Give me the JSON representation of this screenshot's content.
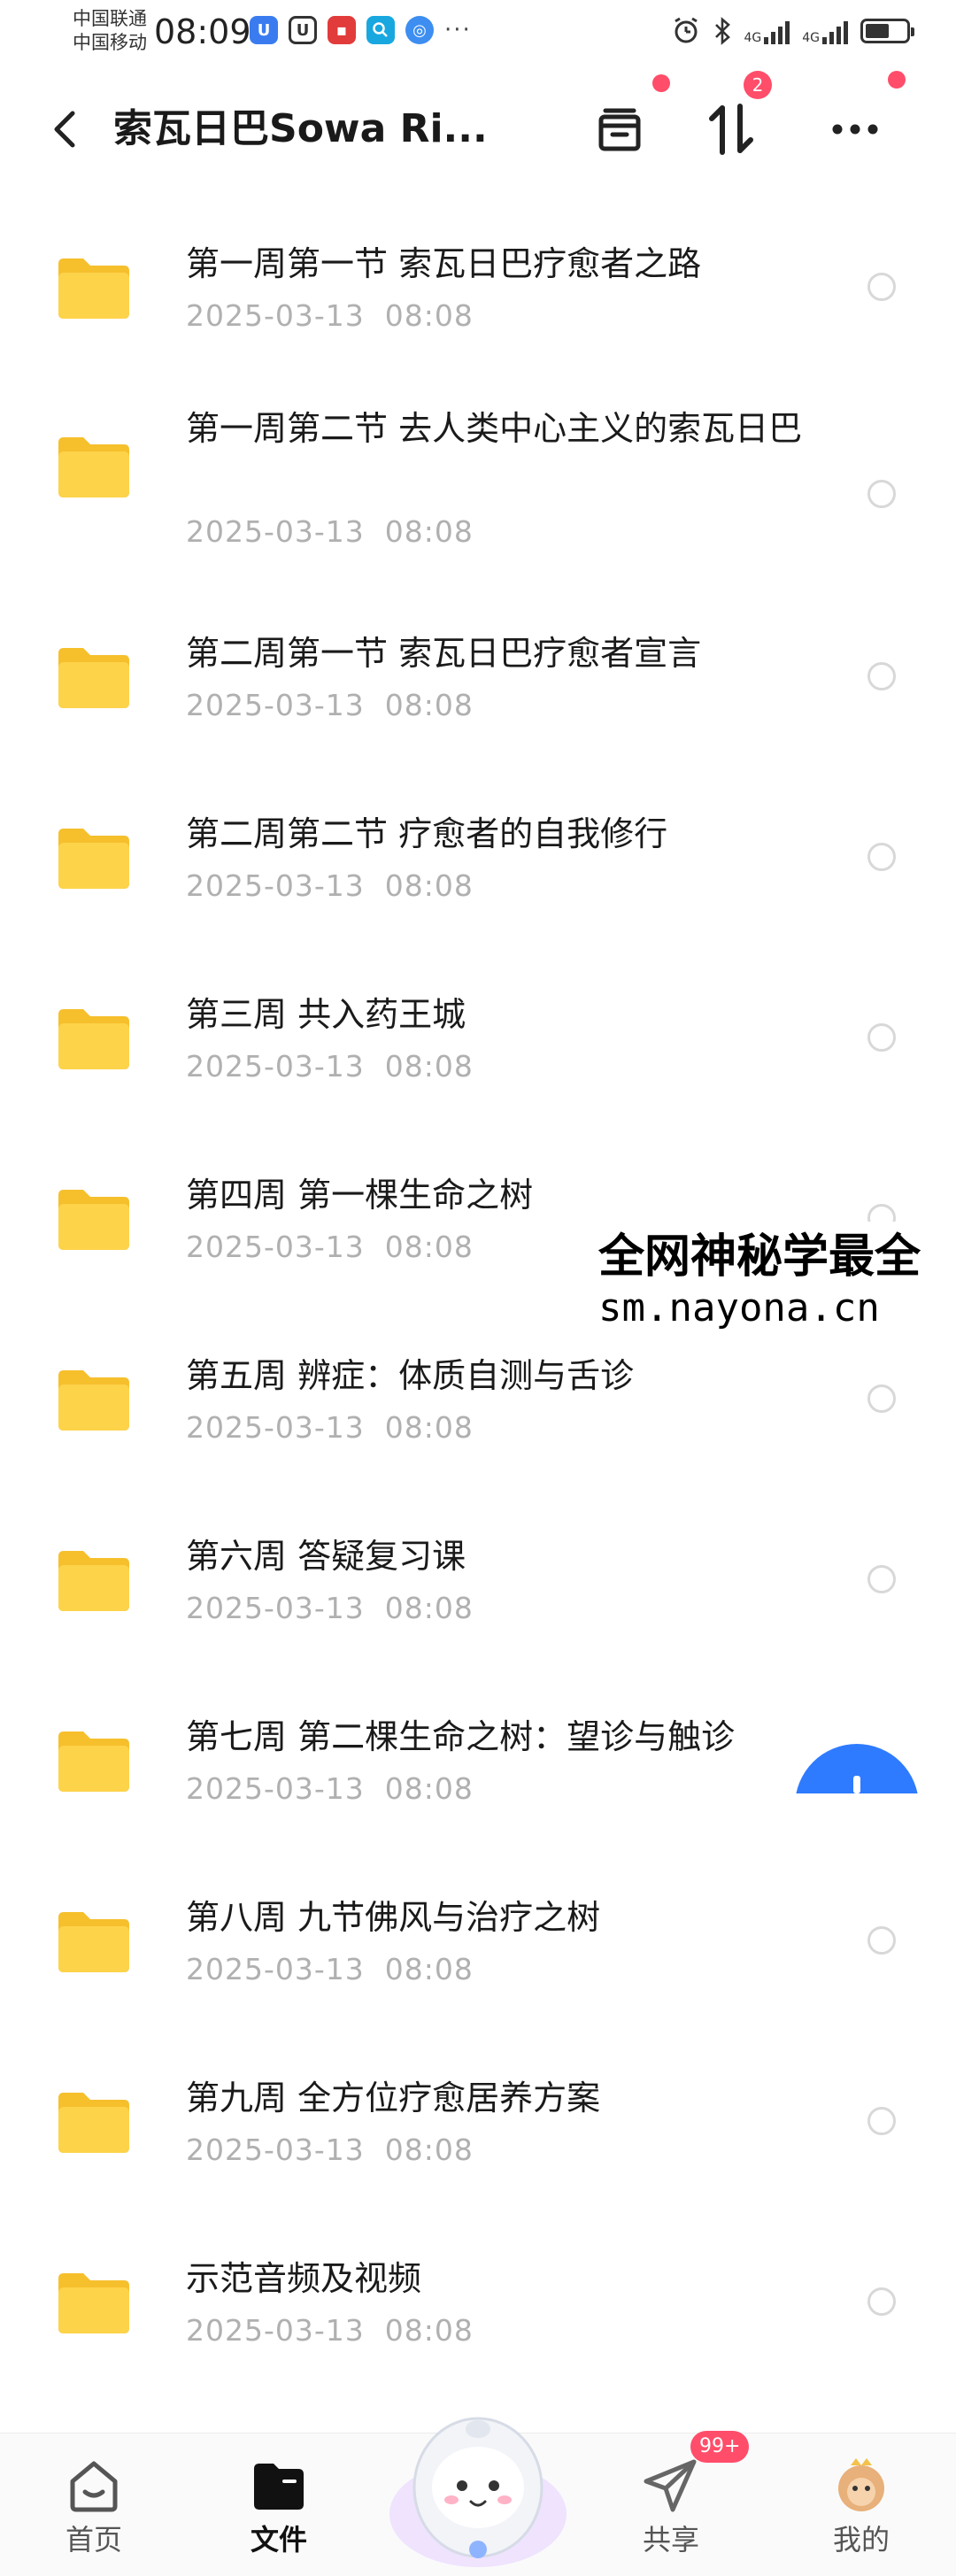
{
  "status_bar": {
    "carrier_1": "中国联通",
    "carrier_2": "中国移动",
    "time": "08:09",
    "more_indicator": "···",
    "network_1": "4G",
    "network_2": "4G"
  },
  "header": {
    "title": "索瓦日巴Sowa Ri...",
    "sort_badge_count": "2",
    "icons": {
      "back": "chevron-left-icon",
      "archive": "archive-box-icon",
      "sort": "sort-arrows-icon",
      "more": "more-dots-icon"
    }
  },
  "files": [
    {
      "name": "第一周第一节 索瓦日巴疗愈者之路",
      "date": "2025-03-13  08:08"
    },
    {
      "name": "第一周第二节 去人类中心主义的索瓦日巴",
      "date": "2025-03-13  08:08"
    },
    {
      "name": "第二周第一节 索瓦日巴疗愈者宣言",
      "date": "2025-03-13  08:08"
    },
    {
      "name": "第二周第二节 疗愈者的自我修行",
      "date": "2025-03-13  08:08"
    },
    {
      "name": "第三周 共入药王城",
      "date": "2025-03-13  08:08"
    },
    {
      "name": "第四周 第一棵生命之树",
      "date": "2025-03-13  08:08"
    },
    {
      "name": "第五周 辨症：体质自测与舌诊",
      "date": "2025-03-13  08:08"
    },
    {
      "name": "第六周 答疑复习课",
      "date": "2025-03-13  08:08"
    },
    {
      "name": "第七周 第二棵生命之树：望诊与触诊",
      "date": "2025-03-13  08:08"
    },
    {
      "name": "第八周 九节佛风与治疗之树",
      "date": "2025-03-13  08:08"
    },
    {
      "name": "第九周 全方位疗愈居养方案",
      "date": "2025-03-13  08:08"
    },
    {
      "name": "示范音频及视频",
      "date": "2025-03-13  08:08"
    }
  ],
  "watermark": {
    "title": "全网神秘学最全",
    "url": "sm.nayona.cn"
  },
  "tab_bar": {
    "tabs": [
      {
        "label": "首页",
        "icon": "home-icon"
      },
      {
        "label": "文件",
        "icon": "folder-icon",
        "active": true
      },
      {
        "label": "共享",
        "icon": "paper-plane-icon"
      },
      {
        "label": "我的",
        "icon": "avatar-icon"
      }
    ],
    "share_badge": "99+"
  },
  "colors": {
    "accent": "#2e7bff",
    "badge": "#ff4d6a",
    "folder": "#fdd34a",
    "date_text": "#b0b0b0"
  }
}
